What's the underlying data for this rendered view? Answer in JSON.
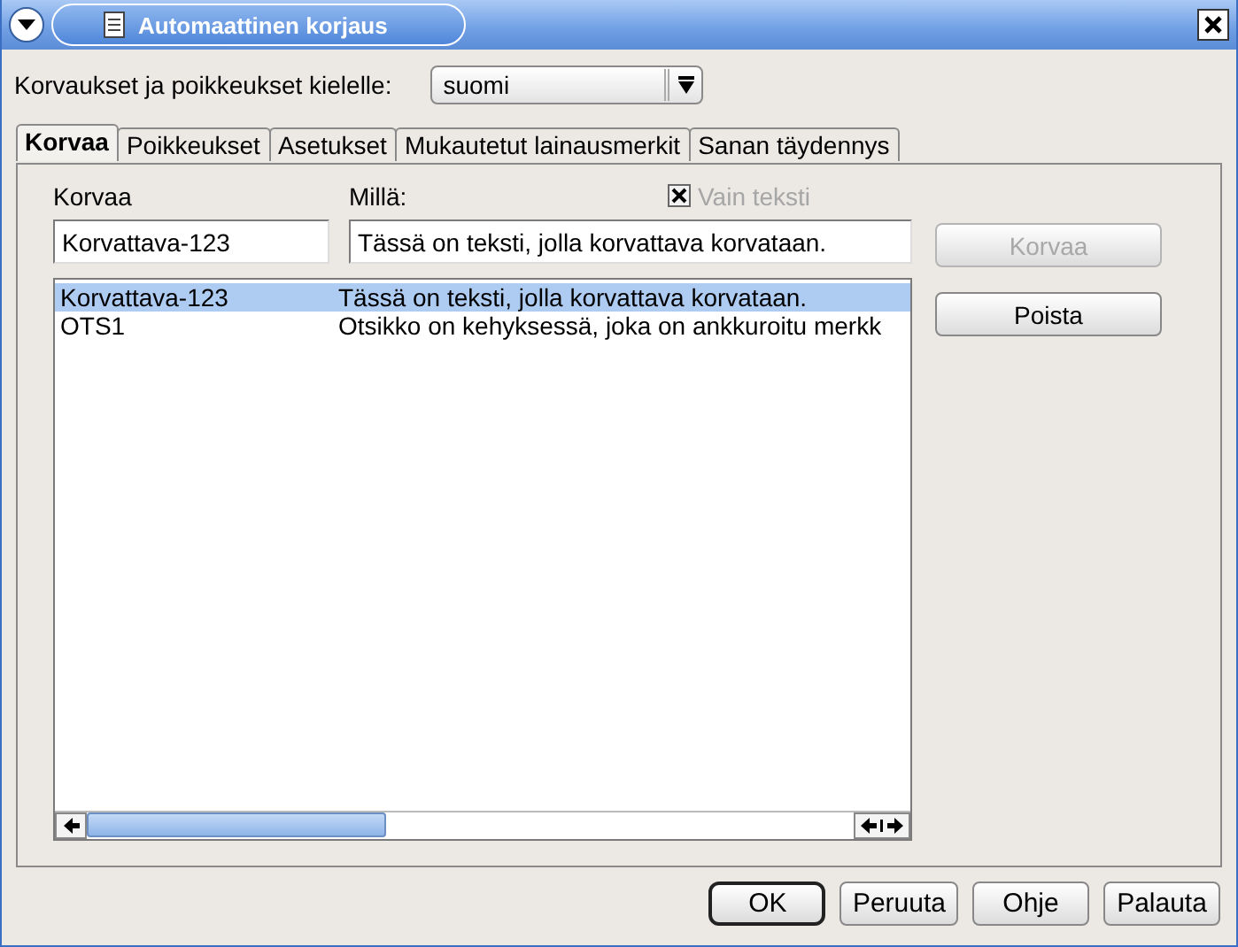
{
  "window": {
    "title": "Automaattinen korjaus"
  },
  "language": {
    "label": "Korvaukset ja poikkeukset kielelle:",
    "value": "suomi"
  },
  "tabs": [
    {
      "label": "Korvaa",
      "selected": true
    },
    {
      "label": "Poikkeukset",
      "selected": false
    },
    {
      "label": "Asetukset",
      "selected": false
    },
    {
      "label": "Mukautetut lainausmerkit",
      "selected": false
    },
    {
      "label": "Sanan täydennys",
      "selected": false
    }
  ],
  "replace_label": "Korvaa",
  "with_label": "Millä:",
  "text_only": {
    "label": "Vain teksti",
    "checked": true,
    "disabled": true
  },
  "replace_field": {
    "value": "Korvattava-123"
  },
  "with_field": {
    "value": "Tässä on teksti, jolla korvattava korvataan."
  },
  "list": {
    "rows": [
      {
        "replace": "Korvattava-123",
        "with": "Tässä on teksti, jolla korvattava korvataan.",
        "selected": true
      },
      {
        "replace": "OTS1",
        "with": "Otsikko on kehyksessä, joka on ankkuroitu merkk",
        "selected": false
      }
    ]
  },
  "side_buttons": [
    {
      "label": "Korvaa",
      "disabled": true
    },
    {
      "label": "Poista",
      "disabled": false
    }
  ],
  "buttons": [
    {
      "label": "OK",
      "default": true
    },
    {
      "label": "Peruuta",
      "default": false
    },
    {
      "label": "Ohje",
      "default": false
    },
    {
      "label": "Palauta",
      "default": false
    }
  ]
}
